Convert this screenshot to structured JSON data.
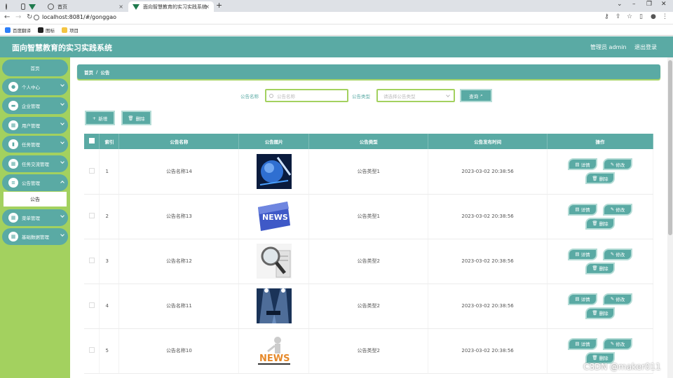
{
  "browser": {
    "tabs": [
      {
        "label": ""
      },
      {
        "label": "首页"
      },
      {
        "label": "面向智慧教育的实习实践系统"
      }
    ],
    "url": "localhost:8081/#/gonggao",
    "bookmarks": [
      "百度翻译",
      "图标",
      "项目"
    ]
  },
  "header": {
    "title": "面向智慧教育的实习实践系统",
    "user": "管理员 admin",
    "logout": "退出登录"
  },
  "sidebar": {
    "home": "首页",
    "items": [
      {
        "label": "个人中心",
        "icon": "person-icon"
      },
      {
        "label": "企业管理",
        "icon": "monitor-icon"
      },
      {
        "label": "用户管理",
        "icon": "grid-icon"
      },
      {
        "label": "任务管理",
        "icon": "chart-icon"
      },
      {
        "label": "任务交流管理",
        "icon": "grid-icon"
      },
      {
        "label": "公告管理",
        "icon": "list-icon"
      },
      {
        "label": "菜单管理",
        "icon": "grid-icon"
      },
      {
        "label": "基础数据管理",
        "icon": "grid-icon"
      }
    ],
    "active_sub": "公告"
  },
  "breadcrumb": {
    "home": "首页",
    "sep": "/",
    "current": "公告"
  },
  "search": {
    "name_label": "公告名称",
    "name_placeholder": "公告名称",
    "type_label": "公告类型",
    "type_placeholder": "请选择公告类型",
    "query_button": "查询"
  },
  "actions": {
    "add": "新增",
    "delete": "删除"
  },
  "table": {
    "headers": [
      "索引",
      "公告名称",
      "公告图片",
      "公告类型",
      "公告发布时间",
      "操作"
    ],
    "rows": [
      {
        "index": "1",
        "name": "公告名称14",
        "type": "公告类型1",
        "time": "2023-03-02 20:38:56",
        "image": "globe-image"
      },
      {
        "index": "2",
        "name": "公告名称13",
        "type": "公告类型1",
        "time": "2023-03-02 20:38:56",
        "image": "news-image"
      },
      {
        "index": "3",
        "name": "公告名称12",
        "type": "公告类型2",
        "time": "2023-03-02 20:38:56",
        "image": "magnifier-image"
      },
      {
        "index": "4",
        "name": "公告名称11",
        "type": "公告类型2",
        "time": "2023-03-02 20:38:56",
        "image": "stage-image"
      },
      {
        "index": "5",
        "name": "公告名称10",
        "type": "公告类型2",
        "time": "2023-03-02 20:38:56",
        "image": "news-figure-image"
      }
    ],
    "op_detail": "详情",
    "op_edit": "修改",
    "op_delete": "删除"
  },
  "watermark": "CSDN @maker011",
  "colors": {
    "primary": "#5aaaa4",
    "sidebar": "#a3d15f",
    "accent_border": "#a3d15f"
  }
}
